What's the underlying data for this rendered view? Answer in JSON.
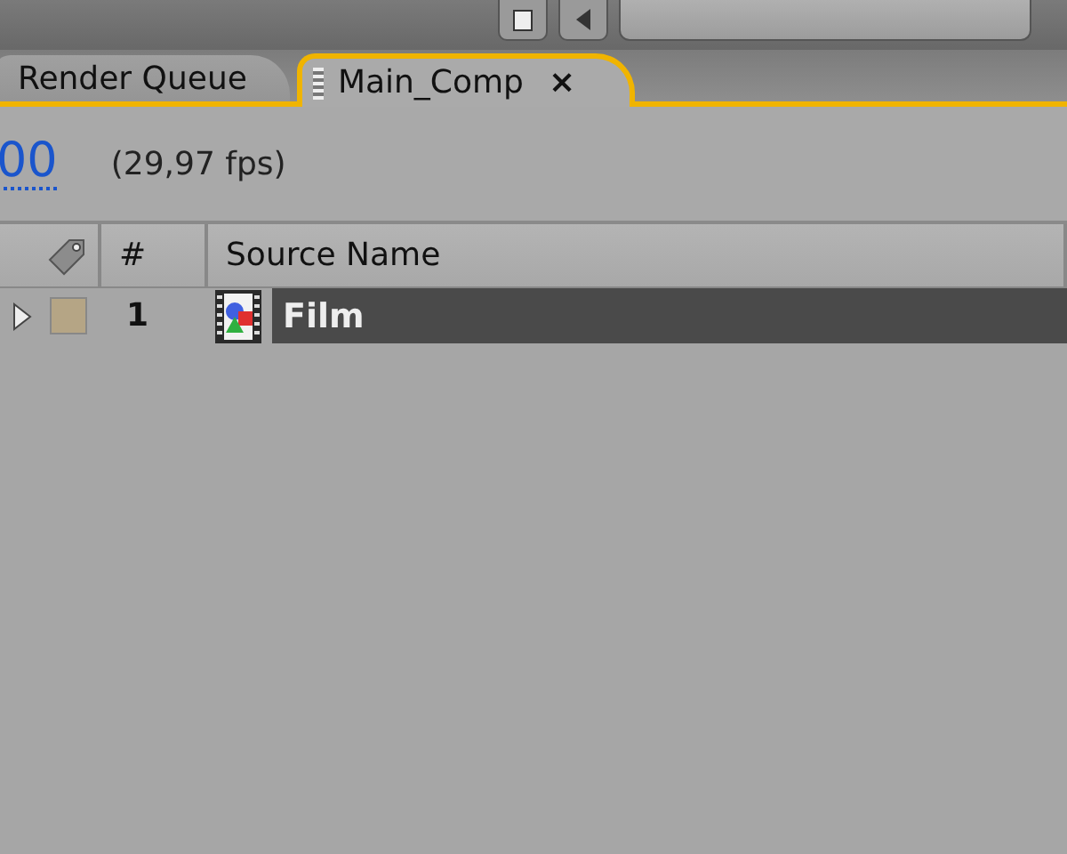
{
  "tabs": [
    {
      "label": "Render Queue",
      "selected": false
    },
    {
      "label": "Main_Comp",
      "selected": true,
      "close": "×"
    }
  ],
  "timecode": "00",
  "frame_rate": "(29,97 fps)",
  "columns": [
    {
      "kind": "label_icon"
    },
    {
      "kind": "text",
      "label": "#"
    },
    {
      "kind": "text",
      "label": "Source Name"
    }
  ],
  "layers": [
    {
      "number": "1",
      "name": "Film",
      "color": "#b5a585",
      "selected": true,
      "expanded": false
    }
  ]
}
